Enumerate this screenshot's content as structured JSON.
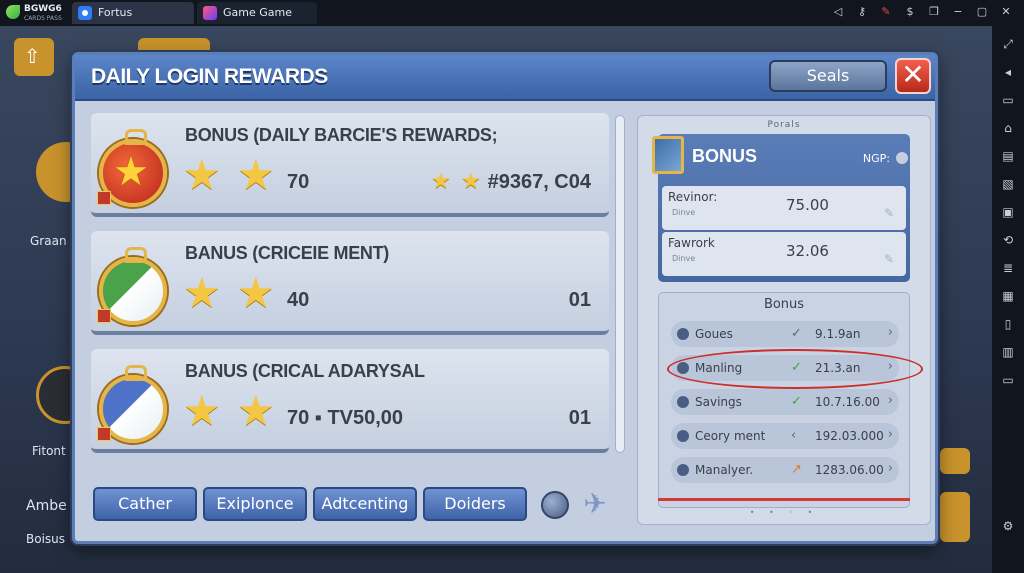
{
  "emulator": {
    "logo_title": "BGWG6",
    "logo_subtitle": "CARDS PASS",
    "tabs": [
      {
        "label": "Fortus",
        "icon": "app-icon"
      },
      {
        "label": "Game Game",
        "icon": "game-icon"
      }
    ],
    "top_icons": [
      "back-icon",
      "key-icon",
      "pen-icon",
      "coin-icon",
      "copy-icon",
      "minimize-icon",
      "restore-icon",
      "close-icon"
    ],
    "right_icons": [
      "expand-icon",
      "volume-icon",
      "screen-icon",
      "macro-icon",
      "apk-icon",
      "screenshot-icon",
      "folder-icon",
      "sync-icon",
      "layers-icon",
      "eco-icon",
      "tablet-icon",
      "settings-icon"
    ]
  },
  "background": {
    "items": [
      "Graan",
      "Fitont",
      "Ambe",
      "Boisus"
    ]
  },
  "dialog": {
    "title": "DAILY LOGIN REWARDS",
    "seals_label": "Seals",
    "close_label": "✕",
    "rewards": [
      {
        "title": "BONUS (DAILY BARCIE'S REWARDS;",
        "value": "70",
        "right": "#9367, C04",
        "mini_stars": true
      },
      {
        "title": "BANUS (CRICEIE MENT)",
        "value": "40",
        "right": "01",
        "mini_stars": false
      },
      {
        "title": "BANUS (CRICAL ADARYSAL",
        "value": "70 ▪ TV50,00",
        "right": "01",
        "mini_stars": false
      }
    ],
    "bottom_tabs": [
      "Cather",
      "Exiplonce",
      "Adtcenting",
      "Doiders"
    ],
    "right_panel": {
      "top_label": "Porals",
      "bonus_card": {
        "title": "BONUS",
        "code": "NGP:",
        "rows": [
          {
            "label": "Revinor:",
            "sub": "Dinve",
            "value": "75.00"
          },
          {
            "label": "Fawrork",
            "sub": "Dinve",
            "value": "32.06"
          }
        ]
      },
      "bonus_list": {
        "title": "Bonus",
        "rows": [
          {
            "label": "Goues",
            "mark": "✓",
            "value": "9.1.9an"
          },
          {
            "label": "Manling",
            "mark": "✓",
            "value": "21.3.an"
          },
          {
            "label": "Savings",
            "mark": "✓",
            "value": "10.7.16.00"
          },
          {
            "label": "Ceory ment",
            "mark": "‹",
            "value": "192.03.000"
          },
          {
            "label": "Manalyer.",
            "mark": "↗",
            "value": "1283.06.00"
          }
        ]
      },
      "pager": "• • ◦ •"
    }
  }
}
